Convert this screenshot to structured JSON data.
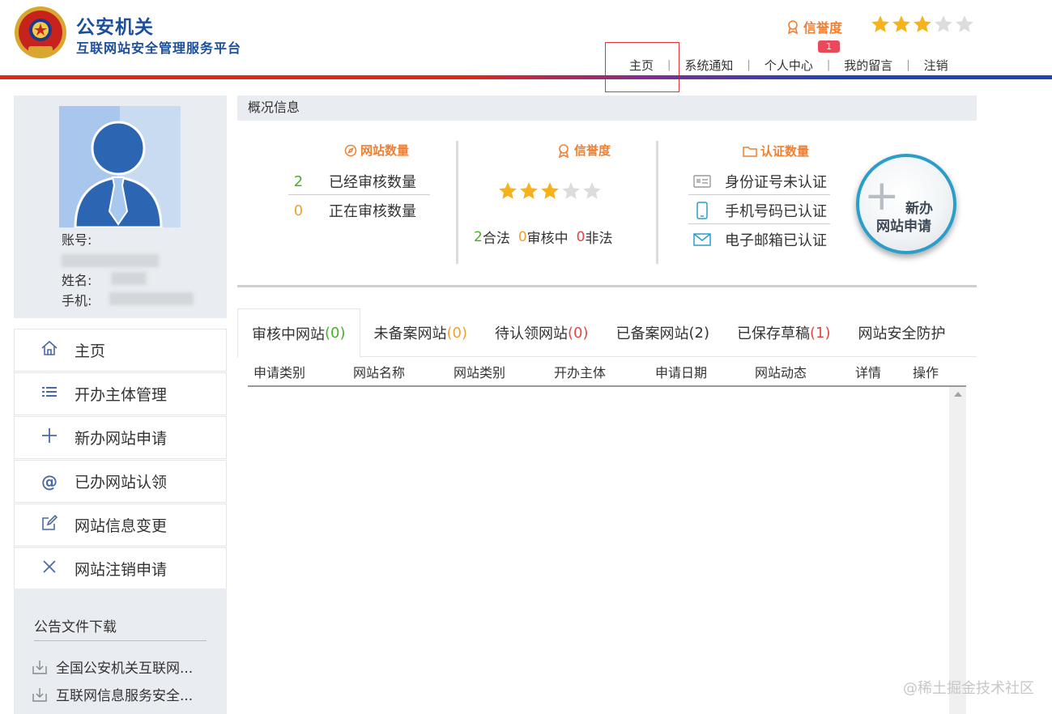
{
  "brand": {
    "title": "公安机关",
    "subtitle": "互联网站安全管理服务平台"
  },
  "header": {
    "credit_label": "信誉度",
    "credit_stars": 3,
    "credit_stars_max": 5,
    "nav": [
      "主页",
      "系统通知",
      "个人中心",
      "我的留言",
      "注销"
    ],
    "notice_badge": "1",
    "accent_colors": {
      "red": "#e0251c",
      "blue": "#1e46b8",
      "orange": "#ef7f32"
    }
  },
  "profile": {
    "account_label": "账号:",
    "name_label": "姓名:",
    "phone_label": "手机:"
  },
  "menu": [
    {
      "label": "主页",
      "icon": "home-icon"
    },
    {
      "label": "开办主体管理",
      "icon": "list-icon"
    },
    {
      "label": "新办网站申请",
      "icon": "plus-icon"
    },
    {
      "label": "已办网站认领",
      "icon": "at-icon"
    },
    {
      "label": "网站信息变更",
      "icon": "edit-icon"
    },
    {
      "label": "网站注销申请",
      "icon": "close-icon"
    }
  ],
  "notices": {
    "title": "公告文件下载",
    "docs": [
      "全国公安机关互联网...",
      "互联网信息服务安全..."
    ]
  },
  "overview": {
    "title": "概况信息",
    "site_count": {
      "title": "网站数量",
      "approved_num": "2",
      "approved_label": "已经审核数量",
      "pending_num": "0",
      "pending_label": "正在审核数量"
    },
    "credit": {
      "title": "信誉度",
      "stars": 3,
      "legal_num": "2",
      "legal_label": "合法",
      "reviewing_num": "0",
      "reviewing_label": "审核中",
      "illegal_num": "0",
      "illegal_label": "非法"
    },
    "auth": {
      "title": "认证数量",
      "id_card": "身份证号未认证",
      "phone": "手机号码已认证",
      "email": "电子邮箱已认证"
    },
    "new_button": {
      "line1": "新办",
      "line2": "网站申请"
    }
  },
  "tabs": [
    {
      "label": "审核中网站",
      "count": "(0)",
      "color": "#4caf2a"
    },
    {
      "label": "未备案网站",
      "count": "(0)",
      "color": "#f0a22e"
    },
    {
      "label": "待认领网站",
      "count": "(0)",
      "color": "#e14848"
    },
    {
      "label": "已备案网站",
      "count": "(2)",
      "color": "#333333"
    },
    {
      "label": "已保存草稿",
      "count": "(1)",
      "color": "#e14848"
    },
    {
      "label": "网站安全防护",
      "count": "",
      "color": "#333333"
    }
  ],
  "table": {
    "columns": [
      "申请类别",
      "网站名称",
      "网站类别",
      "开办主体",
      "申请日期",
      "网站动态",
      "详情",
      "操作"
    ]
  },
  "watermark": "@稀土掘金技术社区"
}
